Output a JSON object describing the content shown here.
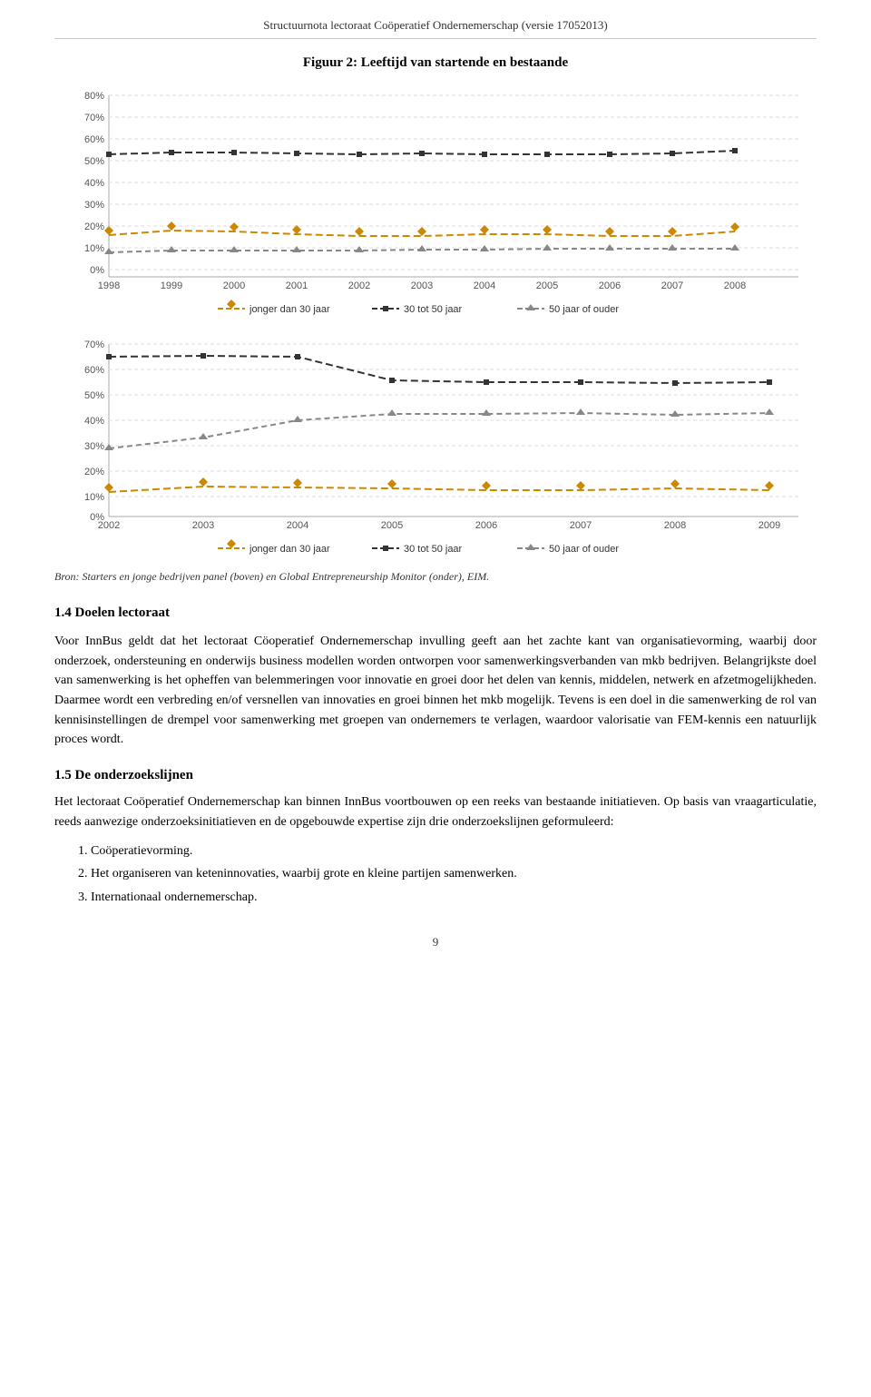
{
  "header": {
    "title": "Structuurnota lectoraat Coöperatief Ondernemerschap (versie 17052013)"
  },
  "figure": {
    "title": "Figuur 2: Leeftijd van startende en bestaande",
    "source": "Bron: Starters en jonge bedrijven panel (boven) en Global Entrepreneurship Monitor (onder), EIM."
  },
  "chart1": {
    "y_labels": [
      "80%",
      "70%",
      "60%",
      "50%",
      "40%",
      "30%",
      "20%",
      "10%",
      "0%"
    ],
    "x_labels": [
      "1998",
      "1999",
      "2000",
      "2001",
      "2002",
      "2003",
      "2004",
      "2005",
      "2006",
      "2007",
      "2008"
    ],
    "legend": [
      "jonger dan 30 jaar",
      "30 tot 50 jaar",
      "50 jaar of ouder"
    ]
  },
  "chart2": {
    "y_labels": [
      "70%",
      "60%",
      "50%",
      "40%",
      "30%",
      "20%",
      "10%",
      "0%"
    ],
    "x_labels": [
      "2002",
      "2003",
      "2004",
      "2005",
      "2006",
      "2007",
      "2008",
      "2009"
    ],
    "legend": [
      "jonger dan 30 jaar",
      "30 tot 50 jaar",
      "50 jaar of ouder"
    ]
  },
  "section14": {
    "heading": "1.4 Doelen lectoraat",
    "paragraph1": "Voor InnBus geldt dat het lectoraat Cöoperatief Ondernemerschap invulling geeft aan het zachte kant van organisatievorming, waarbij door onderzoek, ondersteuning en onderwijs business modellen worden ontworpen voor samenwerkingsverbanden van mkb bedrijven. Belangrijkste doel van samenwerking is het opheffen van belemmeringen voor innovatie en groei door het delen van kennis, middelen, netwerk en afzetmogelijkheden. Daarmee wordt een verbreding en/of versnellen van innovaties en groei binnen het mkb mogelijk. Tevens is een doel in die samenwerking de rol van kennisinstellingen de drempel voor samenwerking met groepen van ondernemers te verlagen, waardoor valorisatie van FEM-kennis een natuurlijk proces wordt."
  },
  "section15": {
    "heading": "1.5 De onderzoekslijnen",
    "paragraph1": "Het lectoraat Coöperatief Ondernemerschap kan binnen InnBus voortbouwen op een reeks van bestaande initiatieven. Op basis van vraagarticulatie, reeds aanwezige onderzoeksinitiatieven en de opgebouwde expertise zijn drie onderzoekslijnen geformuleerd:",
    "list": [
      "Coöperatievorming.",
      "Het organiseren van keteninnovaties, waarbij grote en kleine partijen samenwerken.",
      "Internationaal ondernemerschap."
    ]
  },
  "page_number": "9"
}
